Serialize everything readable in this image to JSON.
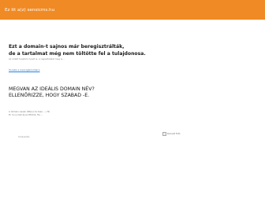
{
  "header": {
    "title": "Ez itt a(z) sensicms.hu"
  },
  "main": {
    "headline_line1": "Ezt a domain-t sajnos már beregisztrálták,",
    "headline_line2": "de a tartalmat még nem töltötte fel a tulajdonosa.",
    "small_note": "Az oldalt hosztoló hoszt is, a regisztrálást meg is...",
    "link_text": "Tovább a kiszolgálóoldalra",
    "question_line1": "MEGVAN AZ IDEÁLIS DOMAIN NÉV?",
    "question_line2": "ELLENŐRIZZE, HOGY SZABAD -E.",
    "detail_line1": "A domain-nevek (http://.hu tesz, ...) fiú",
    "detail_line2": "Pl. hu e-mail és portfoliók, Ha ...",
    "footer_link": "Kiválasztás",
    "image_alt": "Kulcsolt Fotó"
  },
  "colors": {
    "topbar": "#f08a24",
    "link": "#2a7fd8"
  }
}
